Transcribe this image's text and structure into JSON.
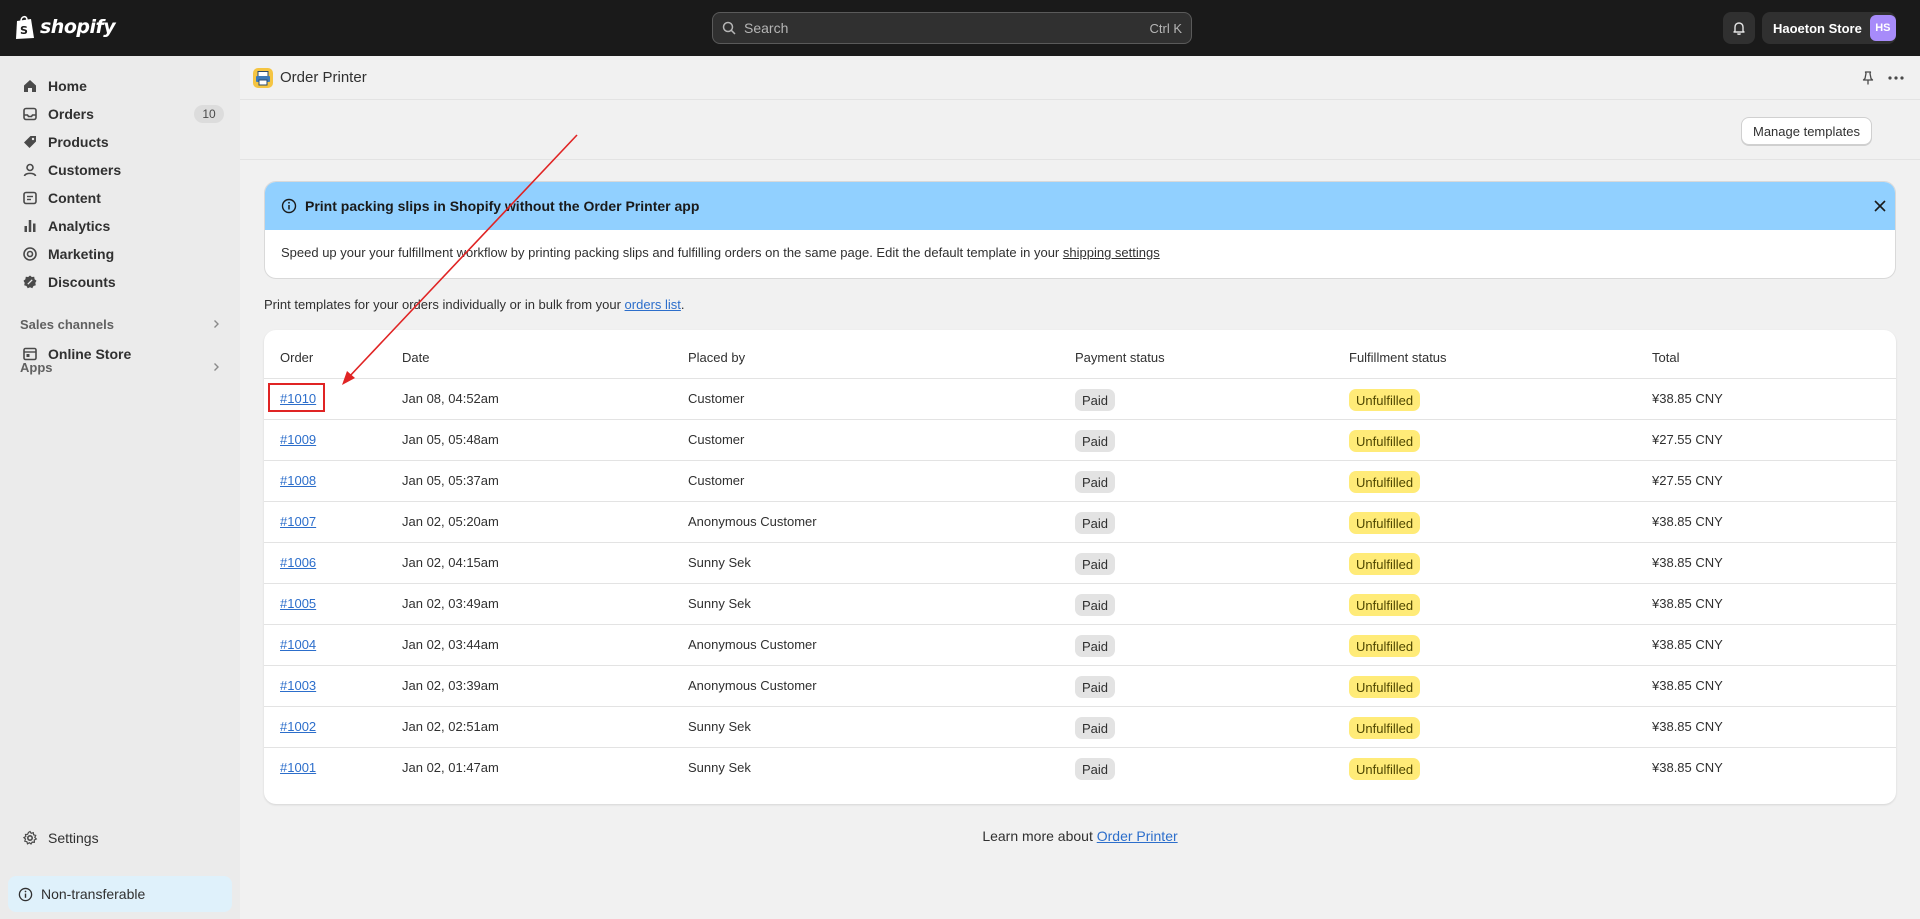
{
  "brand": {
    "name": "shopify"
  },
  "topbar": {
    "search_placeholder": "Search",
    "search_shortcut": "Ctrl K",
    "store_name": "Haoeton Store",
    "avatar_initials": "HS",
    "avatar_color": "#a78bfa"
  },
  "sidebar": {
    "items": [
      {
        "label": "Home",
        "icon": "home-icon"
      },
      {
        "label": "Orders",
        "icon": "orders-icon",
        "badge": "10"
      },
      {
        "label": "Products",
        "icon": "tag-icon"
      },
      {
        "label": "Customers",
        "icon": "person-icon"
      },
      {
        "label": "Content",
        "icon": "content-icon"
      },
      {
        "label": "Analytics",
        "icon": "bar-chart-icon"
      },
      {
        "label": "Marketing",
        "icon": "target-icon"
      },
      {
        "label": "Discounts",
        "icon": "discount-icon"
      }
    ],
    "sales_channels_label": "Sales channels",
    "online_store_label": "Online Store",
    "apps_label": "Apps",
    "settings_label": "Settings",
    "non_transferable_label": "Non-transferable"
  },
  "app": {
    "title": "Order Printer",
    "manage_templates_label": "Manage templates"
  },
  "banner": {
    "title": "Print packing slips in Shopify without the Order Printer app",
    "body_text": "Speed up your your fulfillment workflow by printing packing slips and fulfilling orders on the same page. Edit the default template in your ",
    "body_link": "shipping settings",
    "background": "#91d0ff"
  },
  "intro": {
    "text": "Print templates for your orders individually or in bulk from your ",
    "link": "orders list",
    "suffix": "."
  },
  "table": {
    "headers": {
      "order": "Order",
      "date": "Date",
      "placed_by": "Placed by",
      "payment_status": "Payment status",
      "fulfillment_status": "Fulfillment status",
      "total": "Total"
    },
    "rows": [
      {
        "order": "#1010",
        "date": "Jan 08, 04:52am",
        "placed_by": "Customer",
        "payment": "Paid",
        "fulfillment": "Unfulfilled",
        "total": "¥38.85 CNY"
      },
      {
        "order": "#1009",
        "date": "Jan 05, 05:48am",
        "placed_by": "Customer",
        "payment": "Paid",
        "fulfillment": "Unfulfilled",
        "total": "¥27.55 CNY"
      },
      {
        "order": "#1008",
        "date": "Jan 05, 05:37am",
        "placed_by": "Customer",
        "payment": "Paid",
        "fulfillment": "Unfulfilled",
        "total": "¥27.55 CNY"
      },
      {
        "order": "#1007",
        "date": "Jan 02, 05:20am",
        "placed_by": "Anonymous Customer",
        "payment": "Paid",
        "fulfillment": "Unfulfilled",
        "total": "¥38.85 CNY"
      },
      {
        "order": "#1006",
        "date": "Jan 02, 04:15am",
        "placed_by": "Sunny Sek",
        "payment": "Paid",
        "fulfillment": "Unfulfilled",
        "total": "¥38.85 CNY"
      },
      {
        "order": "#1005",
        "date": "Jan 02, 03:49am",
        "placed_by": "Sunny Sek",
        "payment": "Paid",
        "fulfillment": "Unfulfilled",
        "total": "¥38.85 CNY"
      },
      {
        "order": "#1004",
        "date": "Jan 02, 03:44am",
        "placed_by": "Anonymous Customer",
        "payment": "Paid",
        "fulfillment": "Unfulfilled",
        "total": "¥38.85 CNY"
      },
      {
        "order": "#1003",
        "date": "Jan 02, 03:39am",
        "placed_by": "Anonymous Customer",
        "payment": "Paid",
        "fulfillment": "Unfulfilled",
        "total": "¥38.85 CNY"
      },
      {
        "order": "#1002",
        "date": "Jan 02, 02:51am",
        "placed_by": "Sunny Sek",
        "payment": "Paid",
        "fulfillment": "Unfulfilled",
        "total": "¥38.85 CNY"
      },
      {
        "order": "#1001",
        "date": "Jan 02, 01:47am",
        "placed_by": "Sunny Sek",
        "payment": "Paid",
        "fulfillment": "Unfulfilled",
        "total": "¥38.85 CNY"
      }
    ]
  },
  "footer": {
    "text": "Learn more about ",
    "link": "Order Printer"
  },
  "annotation": {
    "color": "#e02424",
    "highlight_order": "#1010"
  }
}
